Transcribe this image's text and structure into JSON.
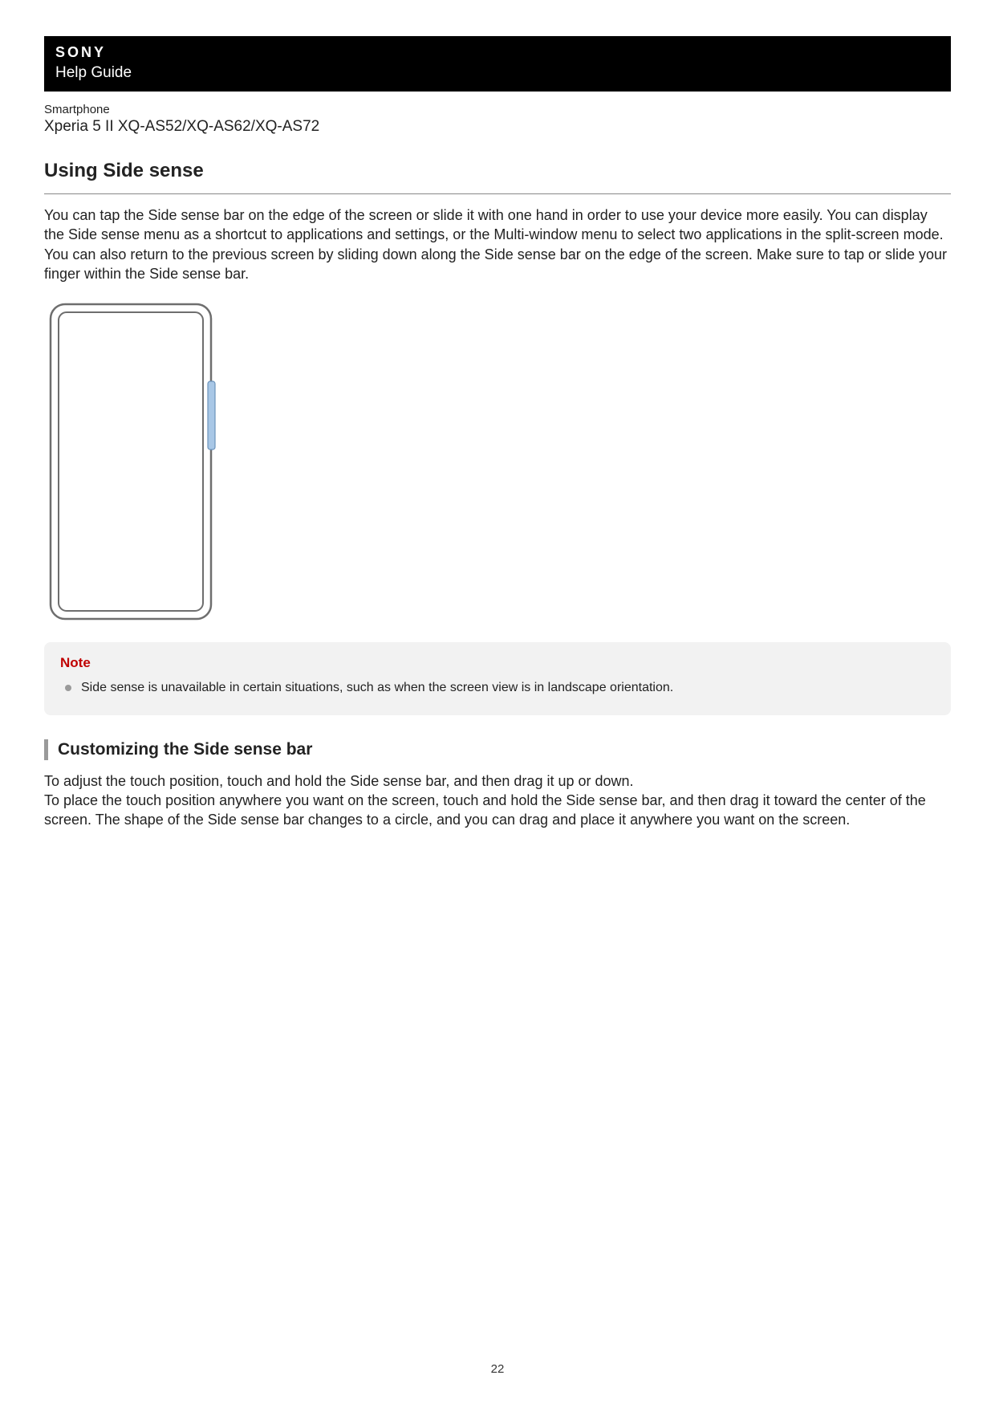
{
  "header": {
    "brand": "SONY",
    "guide": "Help Guide"
  },
  "device": {
    "category": "Smartphone",
    "model": "Xperia 5 II XQ-AS52/XQ-AS62/XQ-AS72"
  },
  "title": "Using Side sense",
  "intro": "You can tap the Side sense bar on the edge of the screen or slide it with one hand in order to use your device more easily. You can display the Side sense menu as a shortcut to applications and settings, or the Multi-window menu to select two applications in the split-screen mode. You can also return to the previous screen by sliding down along the Side sense bar on the edge of the screen. Make sure to tap or slide your finger within the Side sense bar.",
  "note": {
    "label": "Note",
    "items": [
      "Side sense is unavailable in certain situations, such as when the screen view is in landscape orientation."
    ]
  },
  "section": {
    "heading": "Customizing the Side sense bar",
    "body": "To adjust the touch position, touch and hold the Side sense bar, and then drag it up or down.\nTo place the touch position anywhere you want on the screen, touch and hold the Side sense bar, and then drag it toward the center of the screen. The shape of the Side sense bar changes to a circle, and you can drag and place it anywhere you want on the screen."
  },
  "pageNumber": "22"
}
